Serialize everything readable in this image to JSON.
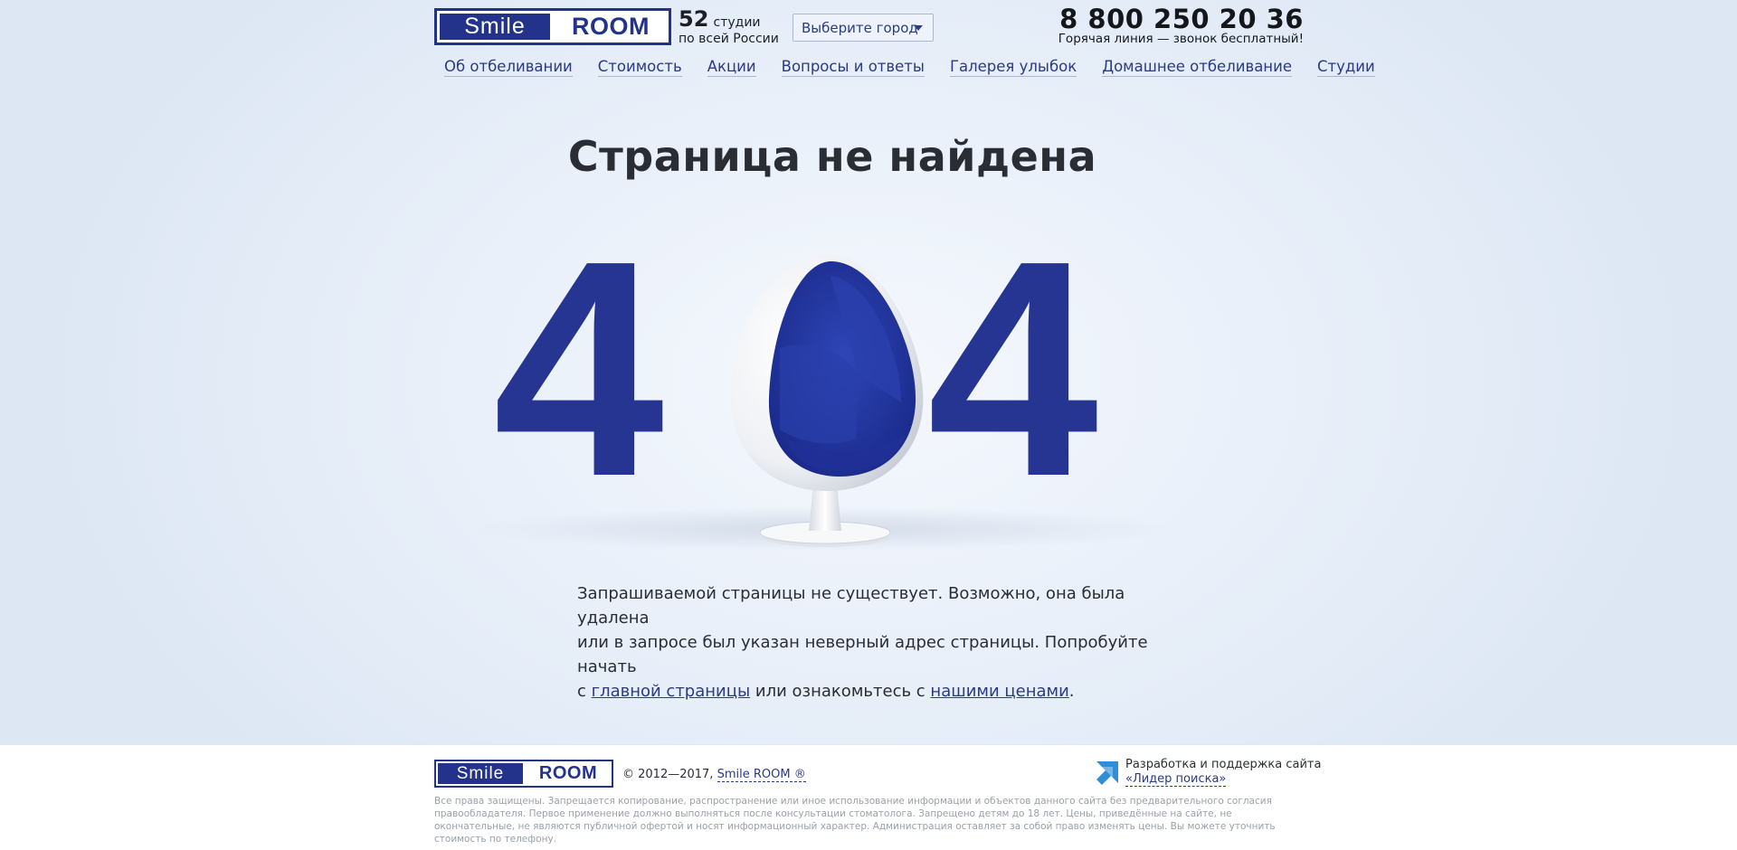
{
  "header": {
    "logo": {
      "smile": "Smile",
      "room": "ROOM"
    },
    "studios": {
      "count": "52",
      "word": "студии",
      "sub": "по всей России"
    },
    "city_select": {
      "label": "Выберите город"
    },
    "phone": {
      "number": "8 800 250 20 36",
      "note": "Горячая линия — звонок бесплатный!"
    }
  },
  "nav": {
    "items": [
      {
        "label": "Об отбеливании"
      },
      {
        "label": "Стоимость"
      },
      {
        "label": "Акции"
      },
      {
        "label": "Вопросы и ответы"
      },
      {
        "label": "Галерея улыбок"
      },
      {
        "label": "Домашнее отбеливание"
      },
      {
        "label": "Студии"
      }
    ]
  },
  "main": {
    "title": "Страница не найдена",
    "big_left": "4",
    "big_right": "4",
    "message": {
      "line1": "Запрашиваемой страницы не существует. Возможно, она была удалена",
      "line2": "или в запросе был указан неверный адрес страницы. Попробуйте начать",
      "prefix": "с ",
      "link_home": "главной страницы",
      "middle": " или ознакомьтесь с ",
      "link_prices": "нашими ценами",
      "suffix": "."
    }
  },
  "footer": {
    "logo": {
      "smile": "Smile",
      "room": "ROOM"
    },
    "copyright_prefix": "© 2012—2017, ",
    "copyright_link": "Smile ROOM ®",
    "dev_line1": "Разработка и поддержка сайта",
    "dev_link": "«Лидер поиска»",
    "legal": "Все права защищены. Запрещается копирование, распространение или иное использование информации и объектов данного сайта без предварительного согласия правообладателя. Первое применение должно выполняться после консультации стоматолога. Запрещено детям до 18 лет. Цены, приведённые на сайте, не окончательные, не являются публичной офертой и носят информационный характер. Администрация оставляет за собой право изменять цены. Вы можете уточнить стоимость по телефону."
  },
  "colors": {
    "brand": "#263592",
    "background": "#e8eff9",
    "text": "#2a2d33"
  }
}
